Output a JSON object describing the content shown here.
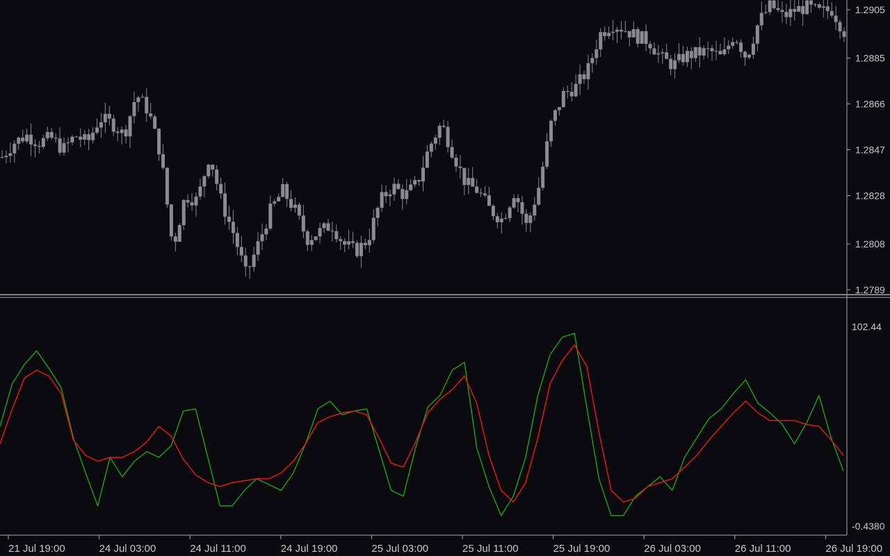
{
  "colors": {
    "background": "#0a0a0f",
    "candle": "#8a8a90",
    "separator": "#a9a9a9",
    "axis_text": "#c8c8c8",
    "stoch_main": "#1f9a1f",
    "stoch_signal": "#e01818"
  },
  "price_axis": {
    "ticks": [
      "1.2905",
      "1.2885",
      "1.2866",
      "1.2847",
      "1.2828",
      "1.2808",
      "1.2789"
    ]
  },
  "indicator_axis": {
    "top": "102.44",
    "bottom": "-0.4380"
  },
  "time_axis": {
    "ticks": [
      "21 Jul 19:00",
      "24 Jul 03:00",
      "24 Jul 11:00",
      "24 Jul 19:00",
      "25 Jul 03:00",
      "25 Jul 11:00",
      "25 Jul 19:00",
      "26 Jul 03:00",
      "26 Jul 11:00",
      "26 Jul 19:00"
    ]
  },
  "chart_data": [
    {
      "type": "candlestick",
      "title": "",
      "ylim": [
        1.2789,
        1.2905
      ],
      "price_ticks": [
        1.2905,
        1.2885,
        1.2866,
        1.2847,
        1.2828,
        1.2808,
        1.2789
      ],
      "x_ticks": [
        "21 Jul 19:00",
        "24 Jul 03:00",
        "24 Jul 11:00",
        "24 Jul 19:00",
        "25 Jul 03:00",
        "25 Jul 11:00",
        "25 Jul 19:00",
        "26 Jul 03:00",
        "26 Jul 11:00",
        "26 Jul 19:00"
      ],
      "close_path": [
        1.2844,
        1.285,
        1.2853,
        1.285,
        1.2852,
        1.2847,
        1.2853,
        1.285,
        1.286,
        1.2858,
        1.2853,
        1.287,
        1.2863,
        1.2845,
        1.2806,
        1.2828,
        1.2826,
        1.2845,
        1.2825,
        1.2812,
        1.2795,
        1.2808,
        1.2822,
        1.283,
        1.2822,
        1.281,
        1.2813,
        1.2816,
        1.2808,
        1.2805,
        1.281,
        1.2826,
        1.2832,
        1.2828,
        1.2833,
        1.2848,
        1.2858,
        1.2845,
        1.2833,
        1.283,
        1.2822,
        1.2818,
        1.283,
        1.2815,
        1.2832,
        1.2858,
        1.287,
        1.2873,
        1.288,
        1.2895,
        1.2899,
        1.2897,
        1.2894,
        1.2892,
        1.2885,
        1.2882,
        1.2886,
        1.2887,
        1.2888,
        1.2885,
        1.2895,
        1.2885,
        1.29,
        1.2907,
        1.2902,
        1.2905,
        1.2906,
        1.2904,
        1.2905,
        1.2896
      ]
    },
    {
      "type": "line",
      "title": "",
      "ylim": [
        -0.438,
        102.44
      ],
      "series": [
        {
          "color": "#1f9a1f",
          "values": [
            51,
            73,
            83,
            90,
            81,
            71,
            45,
            27,
            10,
            35,
            25,
            33,
            38,
            35,
            41,
            59,
            60,
            35,
            10,
            10,
            18,
            24,
            21,
            18,
            27,
            42,
            60,
            64,
            57,
            59,
            60,
            39,
            18,
            15,
            40,
            61,
            67,
            80,
            84,
            40,
            20,
            5,
            15,
            35,
            67,
            88,
            97,
            99,
            61,
            24,
            5,
            5,
            15,
            20,
            25,
            18,
            35,
            45,
            55,
            60,
            68,
            75,
            63,
            58,
            52,
            42,
            53,
            67,
            45,
            28
          ]
        },
        {
          "color": "#e01818",
          "values": [
            42,
            60,
            76,
            80,
            77,
            68,
            44,
            36,
            33,
            35,
            35,
            38,
            43,
            51,
            46,
            34,
            26,
            22,
            20,
            22,
            23,
            24,
            24,
            27,
            33,
            42,
            53,
            56,
            58,
            59,
            57,
            45,
            32,
            30,
            43,
            58,
            65,
            70,
            77,
            63,
            36,
            18,
            12,
            22,
            45,
            73,
            85,
            93,
            82,
            48,
            18,
            12,
            14,
            20,
            22,
            24,
            30,
            36,
            44,
            51,
            58,
            64,
            58,
            54,
            54,
            54,
            52,
            51,
            44,
            36
          ]
        }
      ]
    }
  ]
}
